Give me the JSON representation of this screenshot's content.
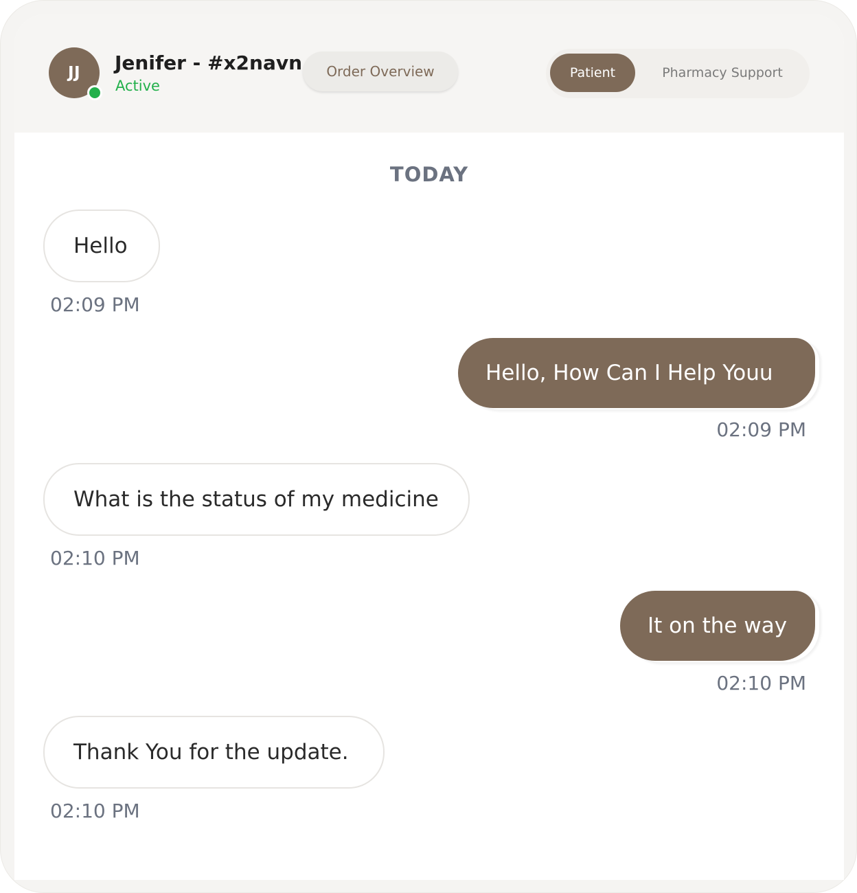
{
  "header": {
    "avatar_initials": "JJ",
    "user_name": "Jenifer - #x2navn",
    "status": "Active",
    "order_overview_label": "Order Overview",
    "tabs": [
      {
        "label": "Patient",
        "selected": true
      },
      {
        "label": "Pharmacy Support",
        "selected": false
      }
    ]
  },
  "chat": {
    "day_label": "TODAY",
    "messages": [
      {
        "direction": "incoming",
        "text": "Hello",
        "time": "02:09 PM"
      },
      {
        "direction": "outgoing",
        "text": "Hello, How Can I Help Youu",
        "time": "02:09 PM"
      },
      {
        "direction": "incoming",
        "text": "What is the status of my medicine",
        "time": "02:10 PM"
      },
      {
        "direction": "outgoing",
        "text": "It on the way",
        "time": "02:10 PM"
      },
      {
        "direction": "incoming",
        "text": "Thank You for the update.",
        "time": "02:10 PM"
      }
    ]
  },
  "colors": {
    "accent": "#7e6a58",
    "online": "#22b04b",
    "muted_text": "#6b7280"
  }
}
